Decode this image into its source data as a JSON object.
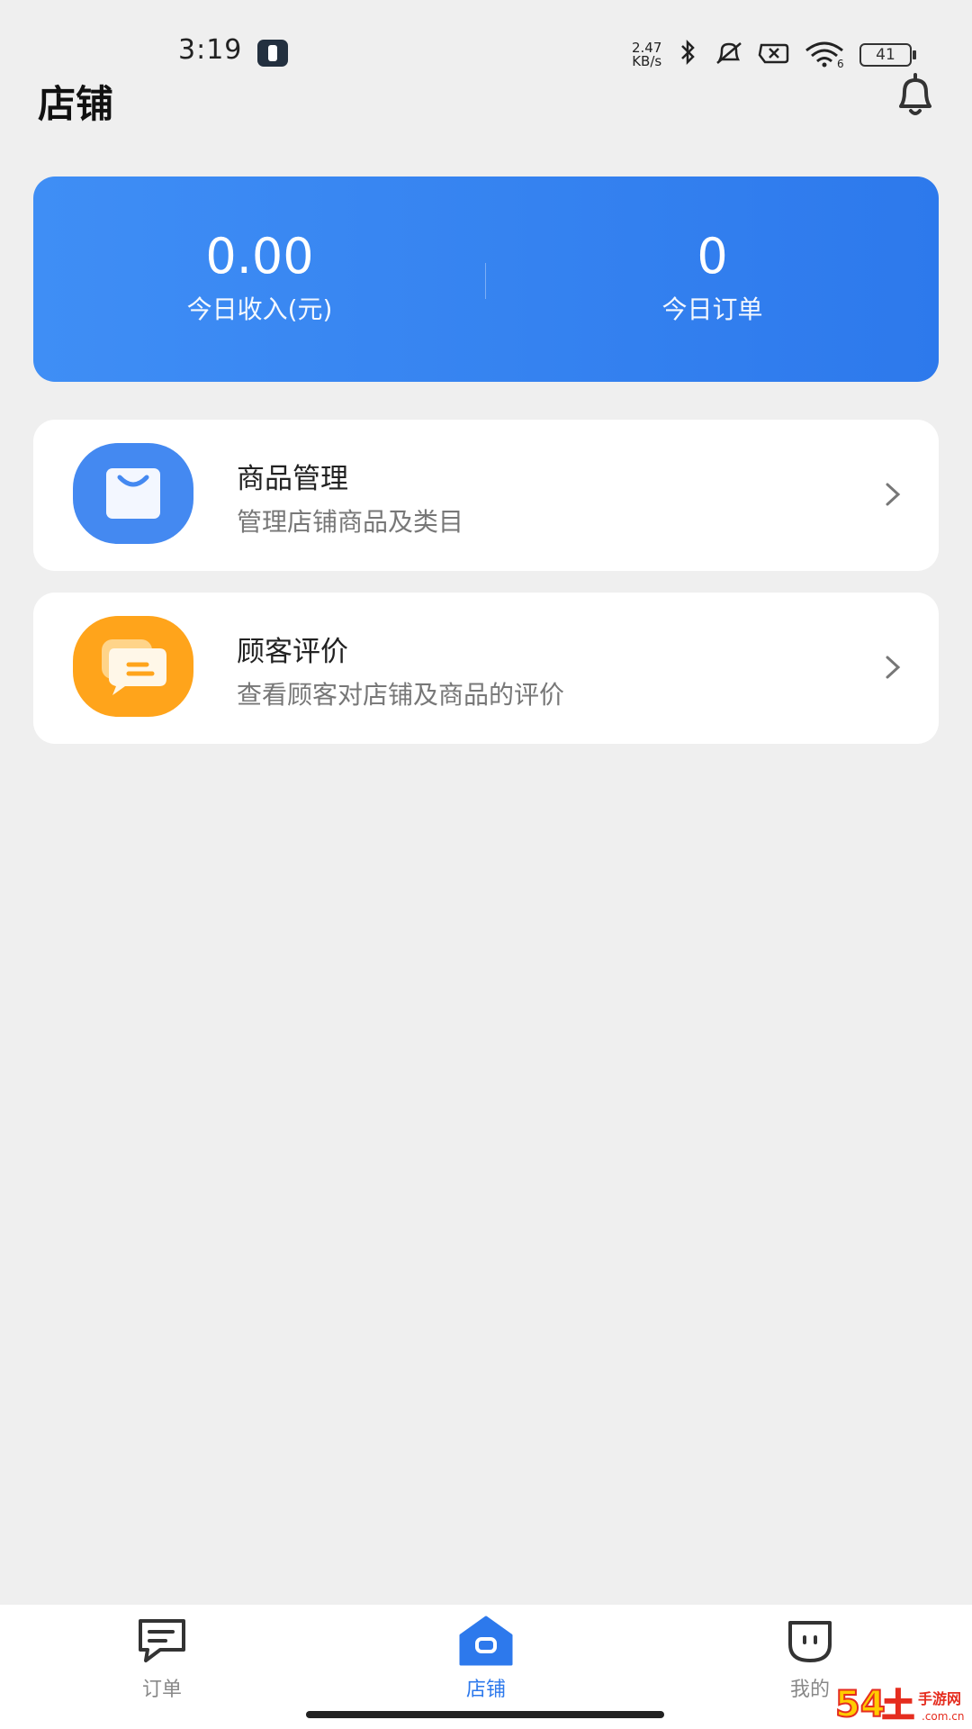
{
  "status_bar": {
    "time": "3:19",
    "net_speed_value": "2.47",
    "net_speed_unit": "KB/s",
    "battery": "41",
    "wifi_badge": "6"
  },
  "header": {
    "title": "店铺"
  },
  "stats": {
    "income_value": "0.00",
    "income_label": "今日收入(元)",
    "orders_value": "0",
    "orders_label": "今日订单"
  },
  "menu": [
    {
      "title": "商品管理",
      "subtitle": "管理店铺商品及类目",
      "icon": "shopping-bag-icon",
      "color": "#3d86f0"
    },
    {
      "title": "顾客评价",
      "subtitle": "查看顾客对店铺及商品的评价",
      "icon": "chat-bubble-icon",
      "color": "#ffa41b"
    }
  ],
  "bottom_nav": [
    {
      "label": "订单",
      "icon": "order-message-icon",
      "active": false
    },
    {
      "label": "店铺",
      "icon": "store-home-icon",
      "active": true
    },
    {
      "label": "我的",
      "icon": "profile-icon",
      "active": false
    }
  ],
  "watermark": {
    "text": "54土手游网",
    "domain": ".com.cn"
  },
  "colors": {
    "accent": "#2d79ec",
    "background": "#efefef",
    "warning": "#ffa41b"
  }
}
